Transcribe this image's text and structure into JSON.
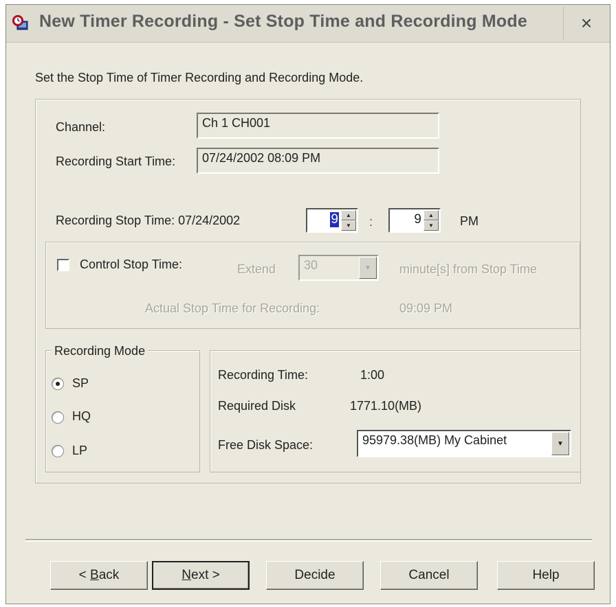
{
  "window": {
    "title": "New Timer Recording - Set Stop Time and Recording Mode",
    "close_glyph": "×"
  },
  "instruction": "Set the Stop Time of Timer Recording and Recording Mode.",
  "channel": {
    "label": "Channel:",
    "value": "Ch 1 CH001"
  },
  "start_time": {
    "label": "Recording Start Time:",
    "value": "07/24/2002 08:09 PM"
  },
  "stop_time": {
    "label": "Recording Stop Time: 07/24/2002",
    "hour": "9",
    "separator": ":",
    "minute": "9",
    "ampm": "PM"
  },
  "control_stop": {
    "checkbox_label": "Control Stop Time:",
    "checked": false,
    "extend_label": "Extend",
    "extend_value": "30",
    "extend_suffix": "minute[s] from Stop Time",
    "actual_label": "Actual Stop Time for Recording:",
    "actual_value": "09:09 PM"
  },
  "recording_mode": {
    "group_label": "Recording Mode",
    "options": [
      {
        "label": "SP",
        "selected": true
      },
      {
        "label": "HQ",
        "selected": false
      },
      {
        "label": "LP",
        "selected": false
      }
    ]
  },
  "info": {
    "recording_time_label": "Recording Time:",
    "recording_time_value": "1:00",
    "required_disk_label": "Required Disk",
    "required_disk_value": "1771.10(MB)",
    "free_disk_label": "Free Disk Space:",
    "free_disk_value": "95979.38(MB) My Cabinet"
  },
  "buttons": {
    "back_prefix": "< ",
    "back_key": "B",
    "back_rest": "ack",
    "next_key": "N",
    "next_rest": "ext >",
    "decide": "Decide",
    "cancel": "Cancel",
    "help": "Help"
  },
  "icons": {
    "app": "timer-recording-app-icon",
    "checkbox": "checkbox-unchecked",
    "dropdown": "chevron-down-icon",
    "spin": "spin-up-down-icon"
  }
}
